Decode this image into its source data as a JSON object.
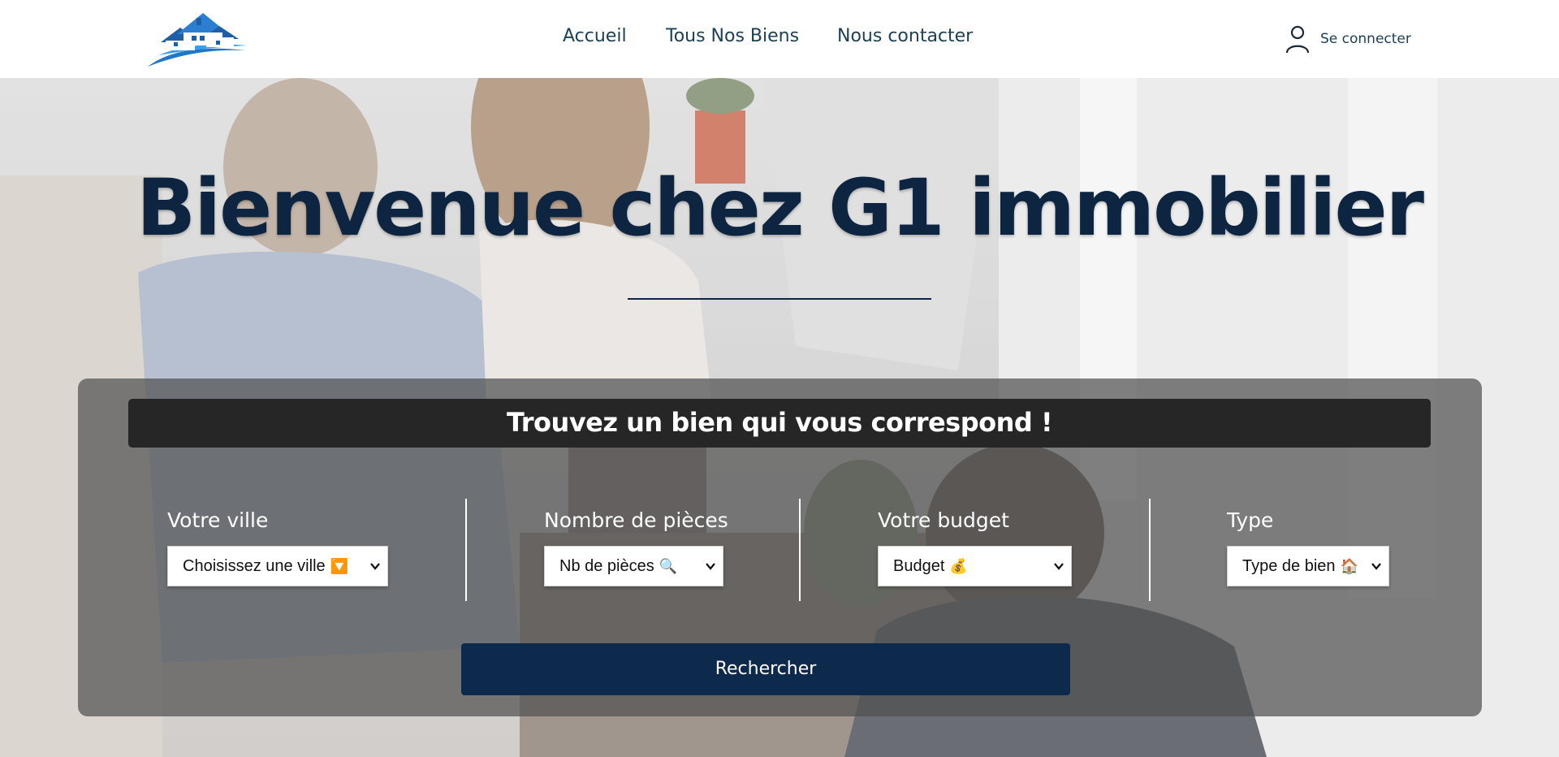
{
  "header": {
    "logo_name": "house-logo",
    "nav": [
      {
        "label": "Accueil"
      },
      {
        "label": "Tous Nos Biens"
      },
      {
        "label": "Nous contacter"
      }
    ],
    "login": {
      "label": "Se connecter",
      "icon": "user-icon"
    }
  },
  "hero": {
    "title": "Bienvenue chez G1 immobilier",
    "background": "photo-couple-agent-handshake"
  },
  "search": {
    "title": "Trouvez un bien qui vous correspond !",
    "filters": [
      {
        "label": "Votre ville",
        "selected": "Choisissez une ville",
        "emoji": "🔽"
      },
      {
        "label": "Nombre de pièces",
        "selected": "Nb de pièces",
        "emoji": "🔍"
      },
      {
        "label": "Votre budget",
        "selected": "Budget",
        "emoji": "💰"
      },
      {
        "label": "Type",
        "selected": "Type de bien",
        "emoji": "🏠"
      }
    ],
    "button_label": "Rechercher"
  },
  "colors": {
    "brand_navy": "#0d2a4c",
    "title_navy": "#0d2541",
    "nav_text": "#1c4157",
    "logo_blue": "#1f77c5"
  }
}
